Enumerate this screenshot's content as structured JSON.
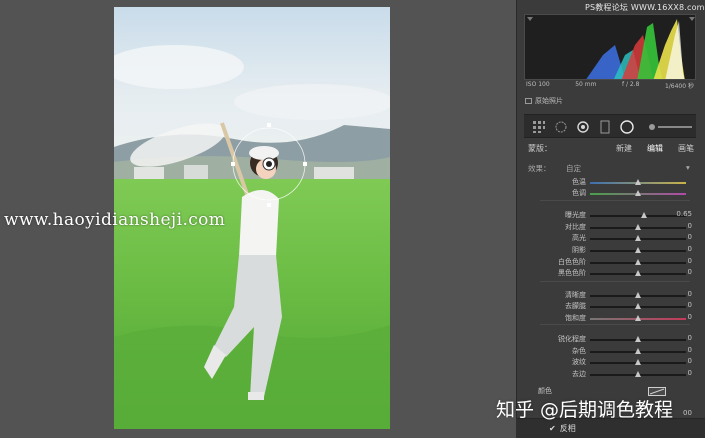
{
  "window": {
    "site_tag": "PS教程论坛 WWW.16XX8.com"
  },
  "histogram": {
    "iso": "ISO 100",
    "focal": "50 mm",
    "aperture": "f / 2.8",
    "shutter": "1/6400 秒",
    "original_photo": "原始照片"
  },
  "mask_header": {
    "title": "蒙版：",
    "new": "新建",
    "edit": "编辑",
    "brush": "画笔"
  },
  "effect": {
    "label": "效果：",
    "value": "自定",
    "arrow": "▾"
  },
  "sliders": [
    {
      "label": "色温",
      "value": "",
      "pos": 0.5,
      "track": "temp"
    },
    {
      "label": "色调",
      "value": "",
      "pos": 0.5,
      "track": "tint"
    },
    {
      "label": "曝光度",
      "value": "0.65",
      "pos": 0.56
    },
    {
      "label": "对比度",
      "value": "0",
      "pos": 0.5
    },
    {
      "label": "高光",
      "value": "0",
      "pos": 0.5
    },
    {
      "label": "阴影",
      "value": "0",
      "pos": 0.5
    },
    {
      "label": "白色色阶",
      "value": "0",
      "pos": 0.5
    },
    {
      "label": "黑色色阶",
      "value": "0",
      "pos": 0.5
    },
    {
      "label": "清晰度",
      "value": "0",
      "pos": 0.5
    },
    {
      "label": "去朦胧",
      "value": "0",
      "pos": 0.5
    },
    {
      "label": "饱和度",
      "value": "0",
      "pos": 0.5,
      "track": "sat"
    },
    {
      "label": "锐化程度",
      "value": "0",
      "pos": 0.5
    },
    {
      "label": "杂色",
      "value": "0",
      "pos": 0.5
    },
    {
      "label": "波纹",
      "value": "0",
      "pos": 0.5
    },
    {
      "label": "去边",
      "value": "0",
      "pos": 0.5
    }
  ],
  "color": {
    "label": "颜色"
  },
  "invert": {
    "check": "✔",
    "label": "反相"
  },
  "overlay": {
    "watermark": "www.haoyidiansheji.com",
    "brand": "知乎 @后期调色教程",
    "zoom_value": "00"
  },
  "colors": {
    "panel_bg": "#3b3b3b",
    "workspace_bg": "#535353",
    "histogram_bg": "#1f1f1f"
  }
}
